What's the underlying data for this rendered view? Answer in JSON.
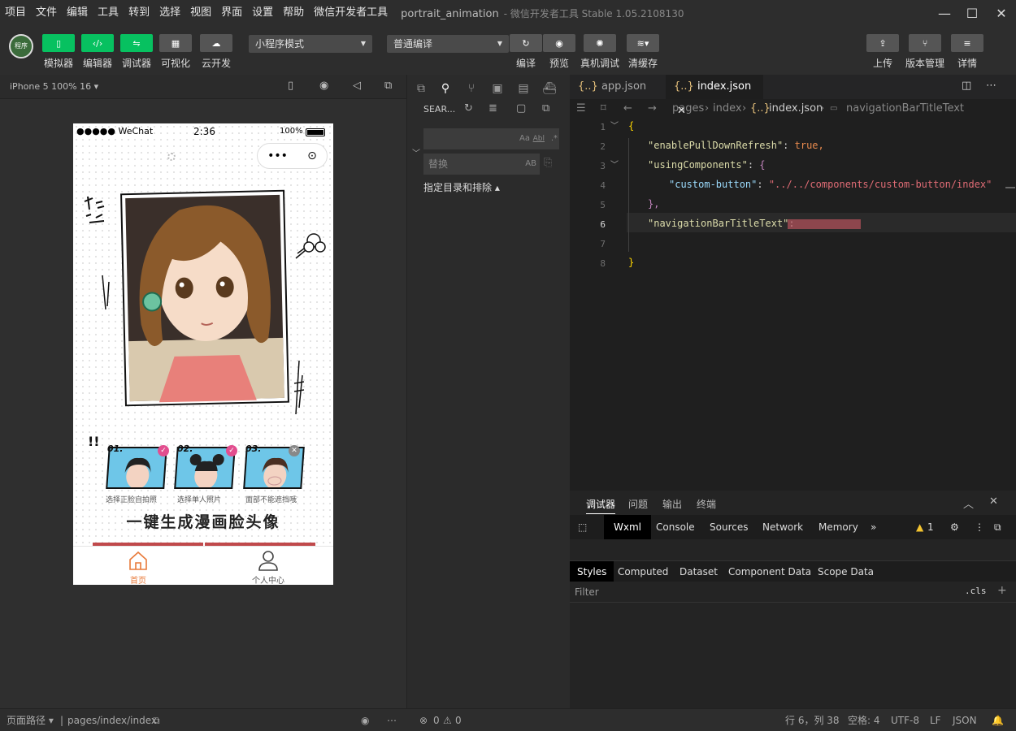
{
  "menubar": {
    "items": [
      "项目",
      "文件",
      "编辑",
      "工具",
      "转到",
      "选择",
      "视图",
      "界面",
      "设置",
      "帮助",
      "微信开发者工具"
    ],
    "title": "portrait_animation",
    "subtitle": "- 微信开发者工具 Stable 1.05.2108130"
  },
  "toolbar": {
    "logo_text": "程序",
    "buttons": [
      {
        "label": "模拟器",
        "icon": "phone-icon"
      },
      {
        "label": "编辑器",
        "icon": "code-icon"
      },
      {
        "label": "调试器",
        "icon": "sliders-icon"
      },
      {
        "label": "可视化",
        "icon": "layout-icon"
      },
      {
        "label": "云开发",
        "icon": "cloud-icon"
      }
    ],
    "mode_select": "小程序模式",
    "compile_select": "普通编译",
    "action_buttons": [
      {
        "label": "编译",
        "icon": "refresh-icon"
      },
      {
        "label": "预览",
        "icon": "eye-icon"
      },
      {
        "label": "真机调试",
        "icon": "bug-icon"
      },
      {
        "label": "清缓存",
        "icon": "layers-icon"
      }
    ],
    "right_buttons": [
      {
        "label": "上传",
        "icon": "upload-icon"
      },
      {
        "label": "版本管理",
        "icon": "branch-icon"
      },
      {
        "label": "详情",
        "icon": "menu-icon"
      }
    ]
  },
  "simulator": {
    "device": "iPhone 5 100% 16",
    "status": {
      "carrier": "●●●●● WeChat",
      "time": "2:36",
      "battery": "100%"
    },
    "capsule": {
      "menu": "•••",
      "close": "⊙"
    },
    "steps": [
      {
        "num": "01.",
        "caption": "选择正脸自拍照",
        "state": "check"
      },
      {
        "num": "02.",
        "caption": "选择单人照片",
        "state": "check"
      },
      {
        "num": "03.",
        "caption": "面部不能遮挡哦",
        "state": "cross"
      }
    ],
    "headline": "一键生成漫画脸头像",
    "tabbar": [
      {
        "label": "首页",
        "active": true
      },
      {
        "label": "个人中心",
        "active": false
      }
    ]
  },
  "explorer": {
    "search_label": "SEAR...",
    "search_opts": [
      "Aa",
      "Abl",
      ".*"
    ],
    "replace_placeholder": "替换",
    "replace_opt": "AB",
    "include_label": "指定目录和排除 ▴"
  },
  "editor": {
    "tabs": [
      {
        "label": "app.json",
        "active": false
      },
      {
        "label": "index.json",
        "active": true
      }
    ],
    "breadcrumbs": [
      "pages",
      "index",
      "index.json",
      "navigationBarTitleText"
    ],
    "current_line": 6,
    "lines": [
      {
        "n": "1",
        "text": "{"
      },
      {
        "n": "2",
        "key": "\"enablePullDownRefresh\"",
        "val": "true,"
      },
      {
        "n": "3",
        "key": "\"usingComponents\"",
        "val": "{"
      },
      {
        "n": "4",
        "key": "\"custom-button\"",
        "val": "\"../../components/custom-button/index\""
      },
      {
        "n": "5",
        "text": "},"
      },
      {
        "n": "6",
        "key": "\"navigationBarTitleText\"",
        "val": ""
      },
      {
        "n": "7",
        "text": ""
      },
      {
        "n": "8",
        "text": "}"
      }
    ]
  },
  "debugger": {
    "panel_tabs": [
      "调试器",
      "问题",
      "输出",
      "终端"
    ],
    "dev_tabs": [
      "Wxml",
      "Console",
      "Sources",
      "Network",
      "Memory"
    ],
    "warning_count": "1",
    "style_tabs": [
      "Styles",
      "Computed",
      "Dataset",
      "Component Data",
      "Scope Data"
    ],
    "filter_placeholder": "Filter",
    "cls": ".cls",
    "plus": "+"
  },
  "statusbar": {
    "path_label": "页面路径",
    "path": "pages/index/index",
    "errors": "0",
    "warnings": "0",
    "position": "行 6，列 38",
    "spaces": "空格: 4",
    "encoding": "UTF-8",
    "eol": "LF",
    "lang": "JSON"
  },
  "colors": {
    "accent_green": "#07c160",
    "tab_active": "#e87a3a",
    "highlight_line": "#2a2a2a"
  }
}
